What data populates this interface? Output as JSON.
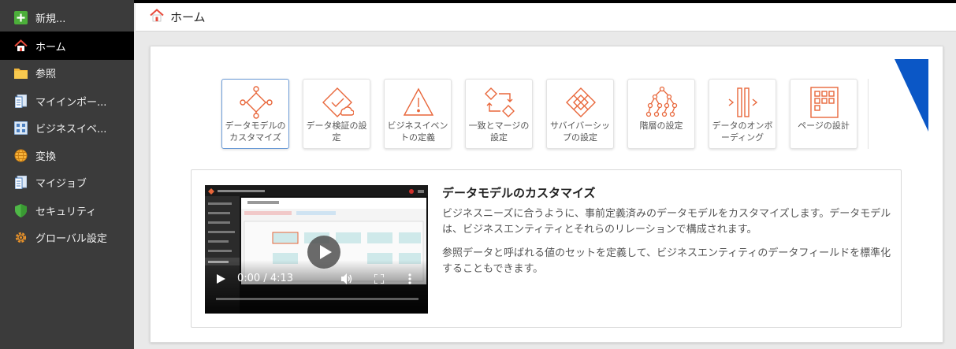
{
  "sidebar": {
    "items": [
      {
        "label": "新規...",
        "icon": "plus-icon"
      },
      {
        "label": "ホーム",
        "icon": "home-icon"
      },
      {
        "label": "参照",
        "icon": "folder-icon"
      },
      {
        "label": "マイインポー...",
        "icon": "import-icon"
      },
      {
        "label": "ビジネスイベ...",
        "icon": "business-event-icon"
      },
      {
        "label": "変換",
        "icon": "globe-icon"
      },
      {
        "label": "マイジョブ",
        "icon": "jobs-icon"
      },
      {
        "label": "セキュリティ",
        "icon": "shield-icon"
      },
      {
        "label": "グローバル設定",
        "icon": "gear-icon"
      }
    ],
    "active_index": 1
  },
  "header": {
    "title": "ホーム",
    "icon": "home-icon"
  },
  "tiles": [
    {
      "label": "データモデルのカスタマイズ",
      "icon": "data-model-icon"
    },
    {
      "label": "データ検証の設定",
      "icon": "data-validation-icon"
    },
    {
      "label": "ビジネスイベントの定義",
      "icon": "warning-icon"
    },
    {
      "label": "一致とマージの設定",
      "icon": "match-merge-icon"
    },
    {
      "label": "サバイバーシップの設定",
      "icon": "survivorship-icon"
    },
    {
      "label": "階層の設定",
      "icon": "hierarchy-icon"
    },
    {
      "label": "データのオンボーディング",
      "icon": "onboarding-icon"
    },
    {
      "label": "ページの設計",
      "icon": "page-design-icon"
    }
  ],
  "detail": {
    "title": "データモデルのカスタマイズ",
    "paragraphs": [
      "ビジネスニーズに合うように、事前定義済みのデータモデルをカスタマイズします。データモデルは、ビジネスエンティティとそれらのリレーションで構成されます。",
      "参照データと呼ばれる値のセットを定義して、ビジネスエンティティのデータフィールドを標準化することもできます。"
    ],
    "video": {
      "time": "0:00 / 4:13"
    }
  },
  "colors": {
    "accent": "#e8663a",
    "sidebar": "#3b3b3b",
    "active": "#000000",
    "brand_blue": "#0b57c6"
  }
}
